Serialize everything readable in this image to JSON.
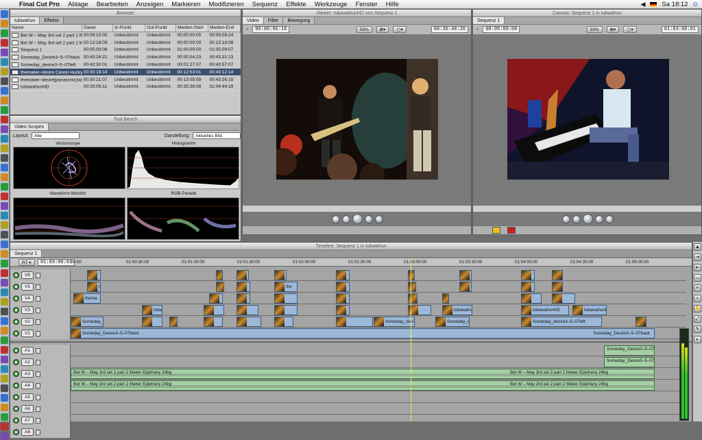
{
  "menubar": {
    "app_name": "Final Cut Pro",
    "items": [
      "Ablage",
      "Bearbeiten",
      "Anzeigen",
      "Markieren",
      "Modifizieren",
      "Sequenz",
      "Effekte",
      "Werkzeuge",
      "Fenster",
      "Hilfe"
    ],
    "clock": "Sa 18:12"
  },
  "browser": {
    "title": "Browser",
    "tabs": [
      "tubwahun",
      "Effekte"
    ],
    "columns": [
      "Name",
      "Dauer",
      "In-Punkt",
      "Out-Punkt",
      "Medien-Start",
      "Medien-End"
    ],
    "rows": [
      {
        "name": "Bet W – May 3rd set 2 part 1 Runaro",
        "dauer": "00:09:10:00",
        "in": "Unbestimmt",
        "out": "Unbestimmt",
        "mstart": "00:00:00:00",
        "mend": "00:09:09:24"
      },
      {
        "name": "Bet W – May 3rd set 2 part 2 Maker",
        "dauer": "00:13:18:09",
        "in": "Unbestimmt",
        "out": "Unbestimmt",
        "mstart": "00:00:00:00",
        "mend": "00:13:18:08"
      },
      {
        "name": "Sequenz 1",
        "dauer": "00:05:09:08",
        "in": "Unbestimmt",
        "out": "Unbestimmt",
        "mstart": "01:00:00:00",
        "mend": "01:05:09:07"
      },
      {
        "name": "Someday_Desire3–5–07back",
        "dauer": "00:43:26:21",
        "in": "Unbestimmt",
        "out": "Unbestimmt",
        "mstart": "00:00:04:23",
        "mend": "00:43:31:13"
      },
      {
        "name": "Someday_desire3–5–07left",
        "dauer": "00:42:30:01",
        "in": "Unbestimmt",
        "out": "Unbestimmt",
        "mstart": "00:01:27:07",
        "mend": "00:43:57:07"
      },
      {
        "name": "themaker–desire Canon Hucky rech",
        "dauer": "00:30:18:14",
        "in": "Unbestimmt",
        "out": "Unbestimmt",
        "mstart": "00:12:53:01",
        "mend": "00:43:12:14",
        "selected": true
      },
      {
        "name": "themaker–desire[panasonic]stage4–",
        "dauer": "00:30:21:07",
        "in": "Unbestimmt",
        "out": "Unbestimmt",
        "mstart": "00:13:05:09",
        "mend": "00:43:26:15"
      },
      {
        "name": "tubawahunHD",
        "dauer": "00:29:06:11",
        "in": "Unbestimmt",
        "out": "Unbestimmt",
        "mstart": "00:35:38:09",
        "mend": "01:04:44:19"
      }
    ]
  },
  "toolbench": {
    "title": "Tool Bench",
    "tab": "Video Scopes",
    "layout_label": "Layout:",
    "layout_value": "Alle",
    "display_label": "Darstellung:",
    "display_value": "Aktuelles Bild",
    "scopes": [
      "Vectorscope",
      "Histogramm",
      "Waveform Monitor",
      "RGB-Parade"
    ]
  },
  "viewer": {
    "title": "Viewer: tubawahunHD von Sequenz 1",
    "tabs": [
      "Video",
      "Filter",
      "Bewegung"
    ],
    "timecode_left": "00:00:06:16",
    "zoom": "59%",
    "timecode_right": "00:36:48:20"
  },
  "canvas": {
    "title": "Canvas: Sequenz 1 in tubwahun",
    "tab": "Sequenz 1",
    "timecode_left": "00:05:09:08",
    "zoom": "59%",
    "timecode_right": "01:03:00:01"
  },
  "timeline": {
    "title": "Timeline: Sequenz 1 in tubwahun",
    "tab": "Sequenz 1",
    "current_tc": "01:03:00:01",
    "ruler": [
      "00:00",
      "01:00:30:00",
      "01:01:00:00",
      "01:01:30:00",
      "01:02:00:00",
      "01:02:30:00",
      "01:03:00:00",
      "01:03:30:00",
      "01:04:00:00",
      "01:04:30:00",
      "01:05:00:00"
    ],
    "video_tracks": [
      "V6",
      "V5",
      "V4",
      "V3",
      "V2",
      "V1"
    ],
    "audio_tracks": [
      "A1",
      "A2",
      "A3",
      "A4",
      "A5",
      "A6",
      "A7",
      "A8"
    ],
    "clip_names": {
      "v1_main": "Someday_Desire3–5–07back",
      "v1_end": "Someday_Desire3–5–07back",
      "v2_a": "Someday_desire3–5–07left",
      "v2_b": "Someday_desire3–5–07left",
      "v3_a": "tubawahunHD",
      "v3_b": "tubawahunHD",
      "v4_a": "thema",
      "v5_a": "the",
      "audio_a3": "Bet W – May 3rd set 2 part 2 Maker Epiphany 24bg",
      "audio_a3_right": "Bet W – May 3rd set 2 part 2 Maker Epiphany 24bg",
      "audio_a1": "Someday_Desire3–5–07bac",
      "audio_a2": "Someday_Desire3–5–07bac"
    }
  },
  "colors": {
    "selection": "#3d4f6e",
    "video_clip": "#9bb8d8",
    "audio_clip": "#a6cfa6"
  }
}
